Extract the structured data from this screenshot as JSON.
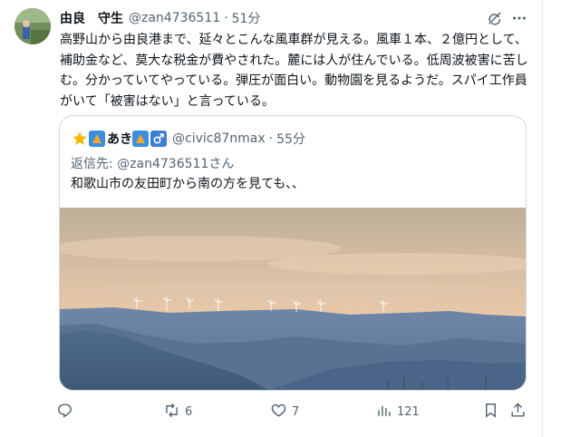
{
  "post": {
    "author_name": "由良　守生",
    "handle": "@zan4736511",
    "separator": "·",
    "time": "51分",
    "text": "高野山から由良港まで、延々とこんな風車群が見える。風車１本、２億円として、補助金など、莫大な税金が費やされた。麓には人が住んでいる。低周波被害に苦しむ。分かっていてやっている。弾圧が面白い。動物園を見るようだ。スパイ工作員がいて「被害はない」と言っている。"
  },
  "quote": {
    "author_name": "あき",
    "handle": "@civic87nmax",
    "separator": "·",
    "time": "55分",
    "reply_to": "返信先: @zan4736511さん",
    "text": "和歌山市の友田町から南の方を見ても、、"
  },
  "actions": {
    "reply_count": "",
    "repost_count": "6",
    "like_count": "7",
    "views_count": "121"
  },
  "icons": [
    "avatar",
    "grok-icon",
    "more-icon",
    "star-icon",
    "badge-icon",
    "male-sign-icon",
    "reply-icon",
    "repost-icon",
    "like-icon",
    "views-icon",
    "bookmark-icon",
    "share-icon"
  ],
  "colors": {
    "text": "#0f1419",
    "secondary": "#536471",
    "border": "#cfd9de"
  }
}
